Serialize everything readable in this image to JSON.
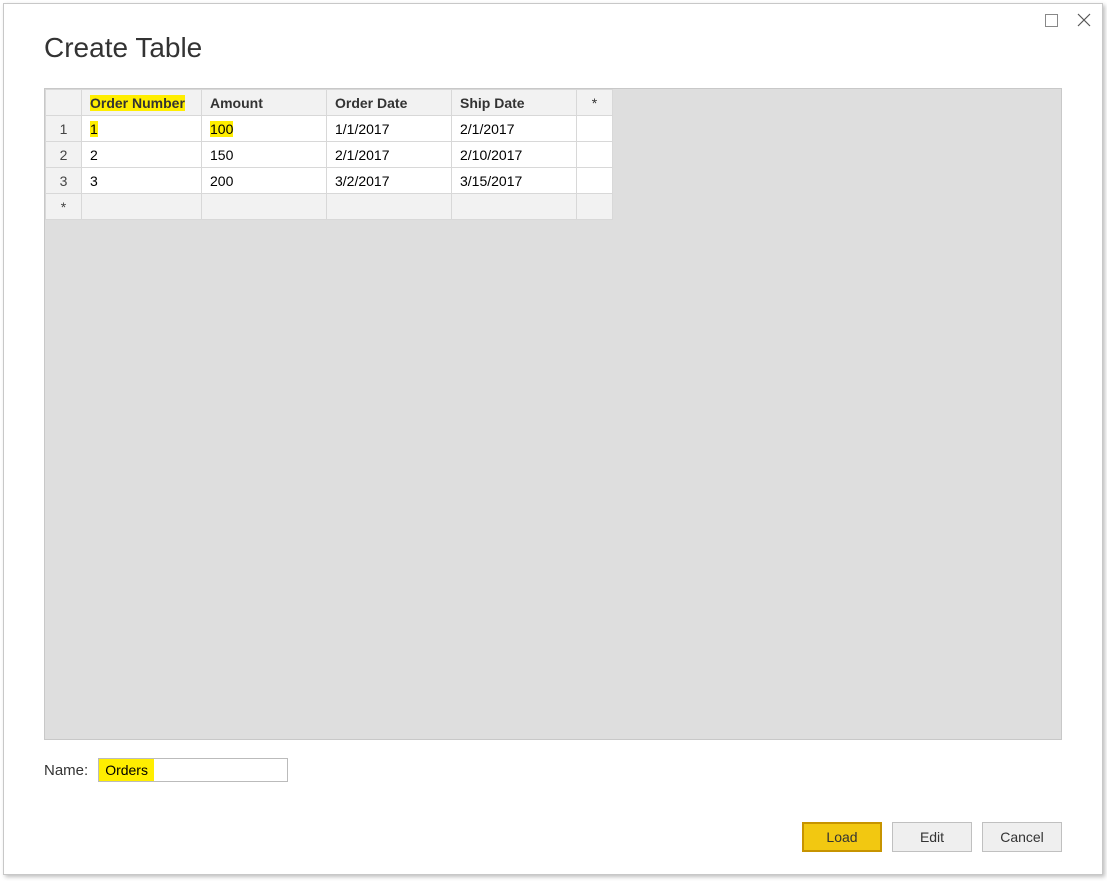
{
  "dialog": {
    "title": "Create Table"
  },
  "grid": {
    "headers": {
      "order_number": "Order Number",
      "amount": "Amount",
      "order_date": "Order Date",
      "ship_date": "Ship Date",
      "star": "*"
    },
    "rows": [
      {
        "idx": "1",
        "order_number": "1",
        "amount": "100",
        "order_date": "1/1/2017",
        "ship_date": "2/1/2017"
      },
      {
        "idx": "2",
        "order_number": "2",
        "amount": "150",
        "order_date": "2/1/2017",
        "ship_date": "2/10/2017"
      },
      {
        "idx": "3",
        "order_number": "3",
        "amount": "200",
        "order_date": "3/2/2017",
        "ship_date": "3/15/2017"
      }
    ],
    "new_row_marker": "*"
  },
  "name": {
    "label": "Name:",
    "value": "Orders"
  },
  "buttons": {
    "load": "Load",
    "edit": "Edit",
    "cancel": "Cancel"
  },
  "highlights": {
    "header_order_number": true,
    "row0_order_number": true,
    "row0_amount": true,
    "name_value": true
  }
}
